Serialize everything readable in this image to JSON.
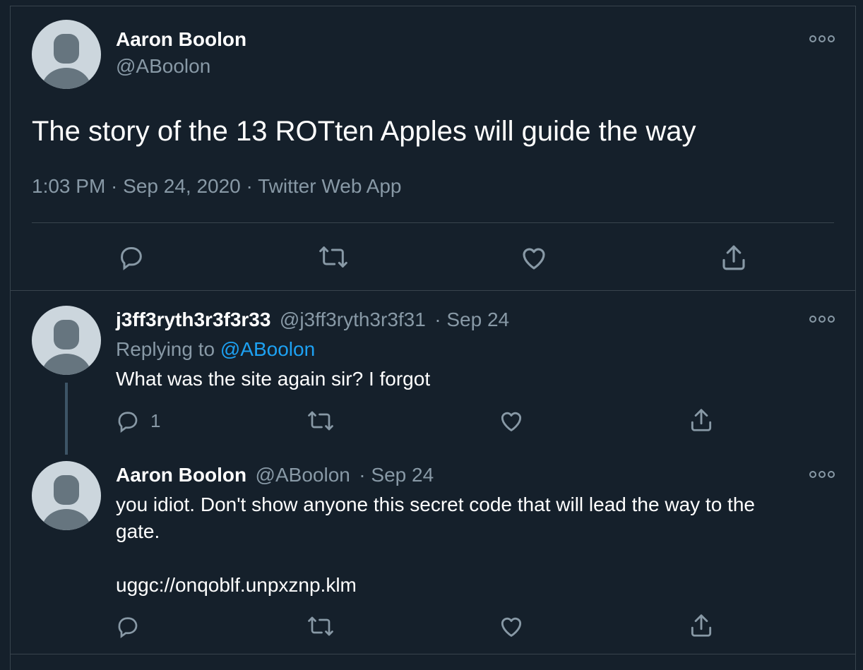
{
  "main_tweet": {
    "author_name": "Aaron Boolon",
    "author_handle": "@ABoolon",
    "text": "The story of the 13 ROTten Apples will guide the way",
    "timestamp": "1:03 PM · Sep 24, 2020 · Twitter Web App"
  },
  "replies": [
    {
      "author_name": "j3ff3ryth3r3f3r33",
      "author_handle": "@j3ff3ryth3r3f31",
      "date": "· Sep 24",
      "replying_prefix": "Replying to",
      "replying_to": "@ABoolon",
      "text": "What was the site again sir? I forgot",
      "reply_count": "1"
    },
    {
      "author_name": "Aaron Boolon",
      "author_handle": "@ABoolon",
      "date": "· Sep 24",
      "text_line1": "you idiot. Don't show anyone this secret code that will lead the way to the",
      "text_line2": "gate.",
      "code": "uggc://onqoblf.unpxznp.klm"
    }
  ],
  "icons": [
    "more-icon",
    "reply-icon",
    "retweet-icon",
    "like-icon",
    "share-icon"
  ],
  "colors": {
    "background": "#15202b",
    "border": "#38444d",
    "secondary_text": "#8899a6",
    "link": "#1da1f2",
    "avatar_bg": "#ccd6dd",
    "avatar_fg": "#66757f"
  }
}
